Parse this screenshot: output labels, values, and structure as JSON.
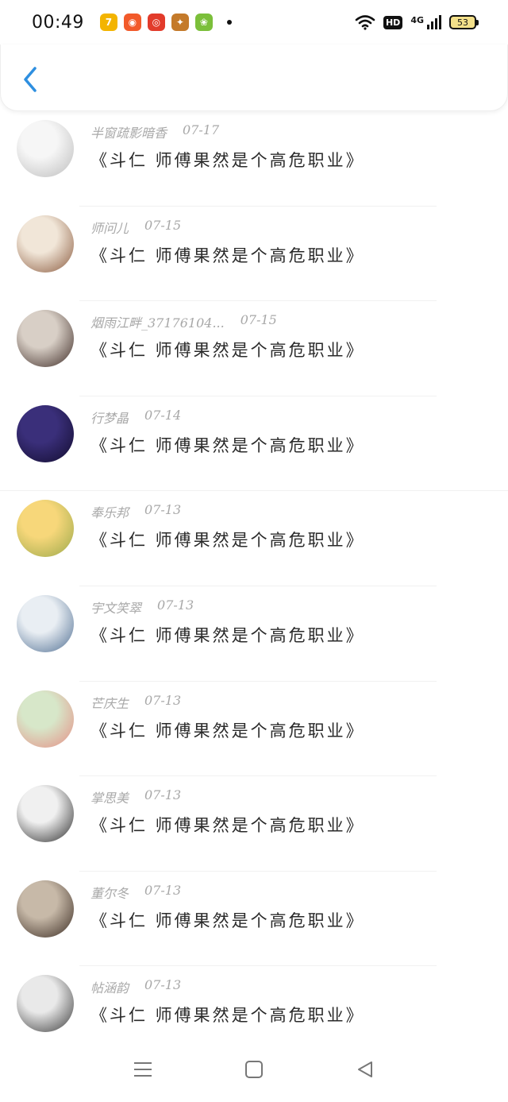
{
  "status": {
    "time": "00:49",
    "network": "4G",
    "hd": "HD",
    "battery": "53",
    "apps": [
      {
        "icon": "app-7-icon",
        "glyph": "7",
        "color": "#f3b400"
      },
      {
        "icon": "app-store-icon",
        "glyph": "◉",
        "color": "#f25a2a"
      },
      {
        "icon": "app-red-circle-icon",
        "glyph": "◎",
        "color": "#e23b2b"
      },
      {
        "icon": "app-game-icon",
        "glyph": "✦",
        "color": "#c47a2a"
      },
      {
        "icon": "app-leaf-icon",
        "glyph": "❀",
        "color": "#7bbf3a"
      }
    ]
  },
  "header": {
    "back_icon": "chevron-left-icon"
  },
  "items": [
    {
      "name": "半窗疏影暗香",
      "date": "07-17",
      "text": "《斗仁 师傅果然是个高危职业》",
      "avatar_colors": [
        "#f6f6f6",
        "#bcbcbc"
      ],
      "avatar_icon": "face-sketch-icon"
    },
    {
      "name": "师问儿",
      "date": "07-15",
      "text": "《斗仁 师傅果然是个高危职业》",
      "avatar_colors": [
        "#f1e6d8",
        "#8a5a3e"
      ],
      "avatar_icon": "portrait-woman-icon"
    },
    {
      "name": "烟雨江畔_37176104...",
      "date": "07-15",
      "text": "《斗仁 师傅果然是个高危职业》",
      "avatar_colors": [
        "#d8cfc6",
        "#3d2a25"
      ],
      "avatar_icon": "portrait-ancient-icon"
    },
    {
      "name": "行梦晶",
      "date": "07-14",
      "text": "《斗仁 师傅果然是个高危职业》",
      "avatar_colors": [
        "#3a2f7a",
        "#120c2e"
      ],
      "avatar_icon": "galaxy-icon"
    },
    {
      "name": "奉乐邦",
      "date": "07-13",
      "text": "《斗仁 师傅果然是个高危职业》",
      "avatar_colors": [
        "#f7d77a",
        "#9aa84a"
      ],
      "avatar_icon": "toy-figure-icon"
    },
    {
      "name": "宇文笑翠",
      "date": "07-13",
      "text": "《斗仁 师傅果然是个高危职业》",
      "avatar_colors": [
        "#e9eef3",
        "#4f6e92"
      ],
      "avatar_icon": "portrait-girl-icon"
    },
    {
      "name": "芒庆生",
      "date": "07-13",
      "text": "《斗仁 师傅果然是个高危职业》",
      "avatar_colors": [
        "#d7e7c9",
        "#e58e85"
      ],
      "avatar_icon": "flower-icon"
    },
    {
      "name": "掌思美",
      "date": "07-13",
      "text": "《斗仁 师傅果然是个高危职业》",
      "avatar_colors": [
        "#f0f0f0",
        "#2b2b2b"
      ],
      "avatar_icon": "cartoon-boy-icon"
    },
    {
      "name": "董尔冬",
      "date": "07-13",
      "text": "《斗仁 师傅果然是个高危职业》",
      "avatar_colors": [
        "#c7b9a8",
        "#3a2b22"
      ],
      "avatar_icon": "portrait-man-icon"
    },
    {
      "name": "帖涵韵",
      "date": "07-13",
      "text": "《斗仁 师傅果然是个高危职业》",
      "avatar_colors": [
        "#e9e9e9",
        "#3a3a3a"
      ],
      "avatar_icon": "portrait-girl-2-icon"
    }
  ],
  "navbar": {
    "menu_icon": "menu-icon",
    "home_icon": "home-square-icon",
    "back_icon": "back-triangle-icon"
  }
}
